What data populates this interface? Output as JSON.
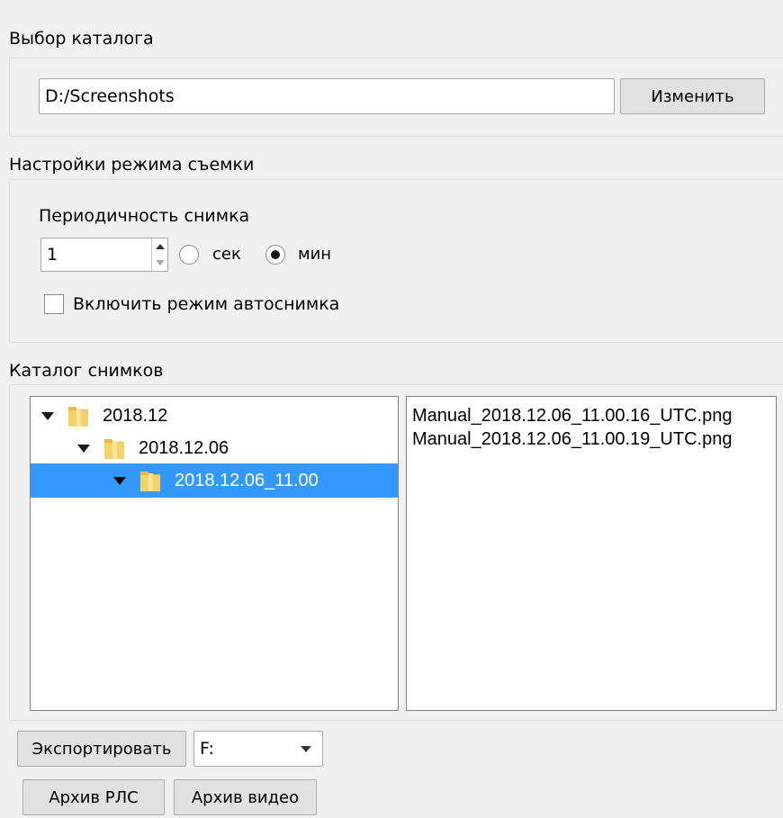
{
  "catalog_select": {
    "label": "Выбор каталога",
    "path_value": "D:/Screenshots",
    "change_button": "Изменить"
  },
  "capture_settings": {
    "label": "Настройки режима съемки",
    "period_label": "Периодичность снимка",
    "period_value": "1",
    "unit_sec": "сек",
    "unit_min": "мин",
    "selected_unit": "мин",
    "autoshot_label": "Включить режим автоснимка",
    "autoshot_checked": false
  },
  "shots_catalog": {
    "label": "Каталог снимков",
    "tree": [
      {
        "label": "2018.12",
        "depth": 0,
        "expanded": true,
        "selected": false
      },
      {
        "label": "2018.12.06",
        "depth": 1,
        "expanded": true,
        "selected": false
      },
      {
        "label": "2018.12.06_11.00",
        "depth": 2,
        "expanded": true,
        "selected": true
      }
    ],
    "files": [
      "Manual_2018.12.06_11.00.16_UTC.png",
      "Manual_2018.12.06_11.00.19_UTC.png"
    ]
  },
  "footer": {
    "export_button": "Экспортировать",
    "drive_value": "F:",
    "radar_archive_button": "Архив РЛС",
    "video_archive_button": "Архив видео"
  },
  "colors": {
    "selection": "#3399ff",
    "window_bg": "#f0f0f0"
  }
}
